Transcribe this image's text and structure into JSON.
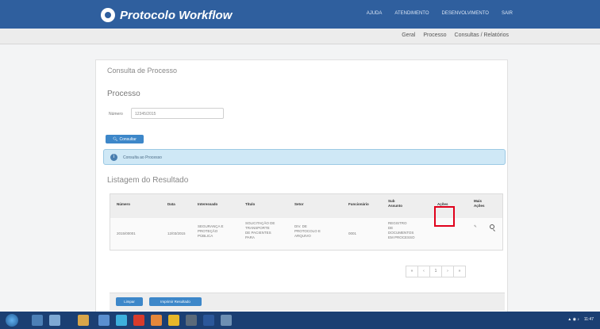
{
  "app": {
    "brand": "Protocolo Workflow"
  },
  "topnav": [
    "AJUDA",
    "ATENDIMENTO",
    "DESENVOLVIMENTO",
    "SAIR"
  ],
  "subnav": [
    "Geral",
    "Processo",
    "Consultas / Relatórios"
  ],
  "page": {
    "title": "Consulta de Processo",
    "section": "Processo",
    "field_label": "Número",
    "field_value": "12345/2015",
    "search_button": "Consultar",
    "alert_message": "Consulta ao Processo",
    "list_title": "Listagem do Resultado"
  },
  "table": {
    "headers": [
      "Número",
      "Data",
      "Interessado",
      "Título",
      "Setor",
      "Funcionário",
      "Sub\nAssunto",
      "Ações",
      "Mais\nAções"
    ],
    "row": [
      "2015/00001",
      "12/03/2015",
      "SEGURANÇA E\nPROTEÇÃO\nPÚBLICA",
      "SOLICITAÇÃO DE\nTRANSPORTE\nDE PACIENTES\nPARA",
      "DIV. DE\nPROTOCOLO E\nARQUIVO",
      "0001",
      "REGISTRO\nDE\nDOCUMENTOS\nEM PROCESSO",
      "",
      "✎"
    ]
  },
  "pagination": [
    "«",
    "‹",
    "1",
    "›",
    "»"
  ],
  "footer_buttons": [
    "Limpar",
    "Imprimir Resultado"
  ],
  "tray": {
    "time": "11:47"
  },
  "colors": {
    "navbar": "#2f5f9e",
    "primary_button": "#3d87c9",
    "alert_bg": "#cfe8f6",
    "highlight": "#e0001b",
    "taskbar": "#1b3f73"
  }
}
